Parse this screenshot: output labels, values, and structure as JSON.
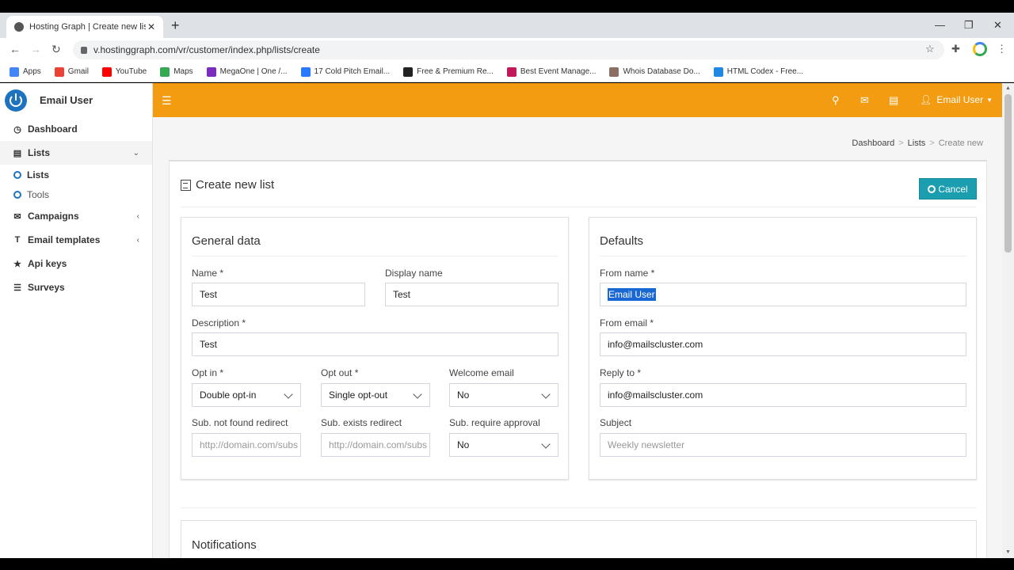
{
  "browser": {
    "tab_title": "Hosting Graph | Create new list",
    "url": "v.hostinggraph.com/vr/customer/index.php/lists/create",
    "bookmarks": [
      {
        "label": "Apps",
        "color": "#4285f4"
      },
      {
        "label": "Gmail",
        "color": "#ea4335"
      },
      {
        "label": "YouTube",
        "color": "#ff0000"
      },
      {
        "label": "Maps",
        "color": "#34a853"
      },
      {
        "label": "MegaOne | One /...",
        "color": "#7b2cbf"
      },
      {
        "label": "17 Cold Pitch Email...",
        "color": "#2979ff"
      },
      {
        "label": "Free & Premium Re...",
        "color": "#222222"
      },
      {
        "label": "Best Event Manage...",
        "color": "#c2185b"
      },
      {
        "label": "Whois Database Do...",
        "color": "#8d6e63"
      },
      {
        "label": "HTML Codex - Free...",
        "color": "#1e88e5"
      }
    ]
  },
  "sidebar": {
    "brand": "Email User",
    "items": [
      {
        "label": "Dashboard",
        "icon": "dashboard-icon",
        "glyph": "◷"
      },
      {
        "label": "Lists",
        "icon": "list-icon",
        "glyph": "▤",
        "chevron": "⌄"
      },
      {
        "label": "Campaigns",
        "icon": "envelope-icon",
        "glyph": "✉",
        "chevron": "‹"
      },
      {
        "label": "Email templates",
        "icon": "text-icon",
        "glyph": "T",
        "chevron": "‹"
      },
      {
        "label": "Api keys",
        "icon": "star-icon",
        "glyph": "★"
      },
      {
        "label": "Surveys",
        "icon": "bars-icon",
        "glyph": "☰"
      }
    ],
    "subitems": [
      {
        "label": "Lists"
      },
      {
        "label": "Tools"
      }
    ]
  },
  "header": {
    "user": "Email User",
    "accent": "#f39c12"
  },
  "breadcrumb": [
    "Dashboard",
    "Lists",
    "Create new"
  ],
  "page": {
    "title": "Create new list",
    "cancel": "Cancel"
  },
  "general": {
    "title": "General data",
    "name_label": "Name *",
    "name_value": "Test",
    "display_label": "Display name",
    "display_value": "Test",
    "desc_label": "Description *",
    "desc_value": "Test",
    "optin_label": "Opt in *",
    "optin_value": "Double opt-in",
    "optout_label": "Opt out *",
    "optout_value": "Single opt-out",
    "welcome_label": "Welcome email",
    "welcome_value": "No",
    "notfound_label": "Sub. not found redirect",
    "notfound_placeholder": "http://domain.com/subs",
    "exists_label": "Sub. exists redirect",
    "exists_placeholder": "http://domain.com/subs",
    "approval_label": "Sub. require approval",
    "approval_value": "No"
  },
  "defaults": {
    "title": "Defaults",
    "fromname_label": "From name *",
    "fromname_value": "Email User",
    "fromemail_label": "From email *",
    "fromemail_value": "info@mailscluster.com",
    "replyto_label": "Reply to *",
    "replyto_value": "info@mailscluster.com",
    "subject_label": "Subject",
    "subject_placeholder": "Weekly newsletter"
  },
  "notifications": {
    "title": "Notifications"
  }
}
